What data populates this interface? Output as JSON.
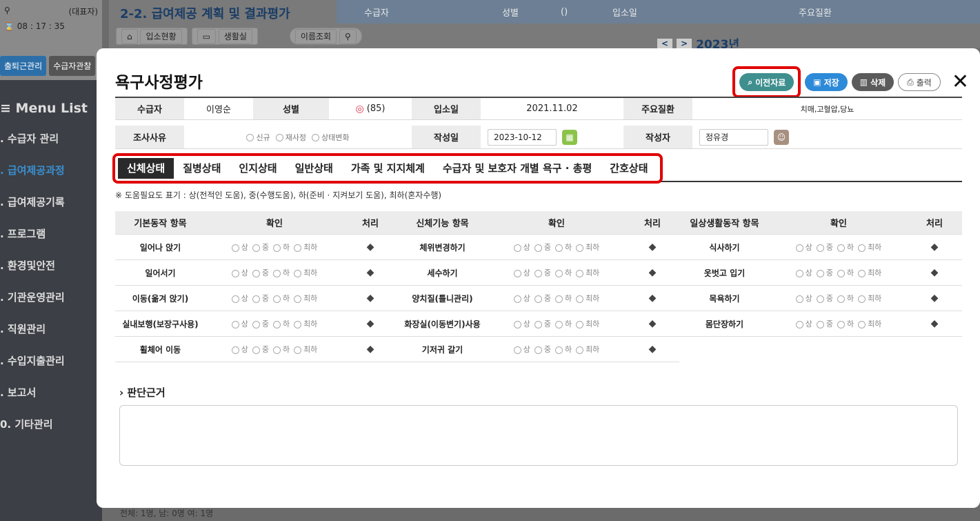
{
  "background": {
    "sidebar": {
      "search_icon": "search-icon",
      "role": "(대표자)",
      "clock": "08 : 17 : 35",
      "btn_attendance": "출퇴근관리",
      "btn_recipient": "수급자관찰",
      "menu_title": "≡ Menu List",
      "items": [
        {
          "label": ". 수급자 관리"
        },
        {
          "label": ". 급여제공과정"
        },
        {
          "label": ". 급여제공기록"
        },
        {
          "label": ". 프로그램"
        },
        {
          "label": ". 환경및안전"
        },
        {
          "label": ". 기관운영관리"
        },
        {
          "label": ". 직원관리"
        },
        {
          "label": ". 수입지출관리"
        },
        {
          "label": ". 보고서"
        },
        {
          "label": "0. 기타관리"
        }
      ],
      "active_arrow": "›"
    },
    "header": {
      "title": "2-2. 급여제공 계획 및 결과평가",
      "bar_recipient": "수급자",
      "bar_gender": "성별",
      "bar_paren": "()",
      "bar_admission": "입소일",
      "bar_disease": "주요질환",
      "tool_admission": "입소현황",
      "tool_room": "생활실",
      "tool_search": "이름조회",
      "year": "2023년",
      "prev_arrow": "<",
      "next_arrow": ">"
    },
    "bottom_text": "전체: 1명,  남: 0명  여: 1명"
  },
  "modal": {
    "title": "욕구사정평가",
    "buttons": {
      "previous": "이전자료",
      "save": "저장",
      "delete": "삭제",
      "print": "출력",
      "close": "✕"
    },
    "info": {
      "recipient_label": "수급자",
      "recipient_value": "이영순",
      "gender_label": "성별",
      "age": "(85)",
      "admission_label": "입소일",
      "admission_value": "2021.11.02",
      "disease_label": "주요질환",
      "disease_value": "치매,고혈압,당뇨",
      "reason_label": "조사사유",
      "reason_options": [
        "신규",
        "재사정",
        "상태변화"
      ],
      "written_date_label": "작성일",
      "written_date_value": "2023-10-12",
      "writer_label": "작성자",
      "writer_value": "정유경"
    },
    "tabs": [
      {
        "label": "신체상태"
      },
      {
        "label": "질병상태"
      },
      {
        "label": "인지상태"
      },
      {
        "label": "일반상태"
      },
      {
        "label": "가족 및 지지체계"
      },
      {
        "label": "수급자 및 보호자 개별 욕구 · 총평"
      },
      {
        "label": "간호상태"
      }
    ],
    "note": "※ 도움필요도 표기 : 상(전적인 도움), 중(수행도움), 하(준비 · 지켜보기 도움), 최하(혼자수행)",
    "grid": {
      "headers": {
        "basic": "기본동작 항목",
        "function": "신체기능 항목",
        "daily": "일상생활동작 항목",
        "check": "확인",
        "action": "처리"
      },
      "levels": [
        "상",
        "중",
        "하",
        "최하"
      ],
      "basic_items": [
        "일어나 앉기",
        "일어서기",
        "이동(옮겨 앉기)",
        "실내보행(보장구사용)",
        "휠체어 이동"
      ],
      "function_items": [
        "체위변경하기",
        "세수하기",
        "양치질(틀니관리)",
        "화장실(이동변기)사용",
        "기저귀 갈기"
      ],
      "daily_items": [
        "식사하기",
        "옷벗고 입기",
        "목욕하기",
        "몸단장하기"
      ]
    },
    "judge_title": "판단근거",
    "judge_arrow": "›"
  },
  "colors": {
    "previous_btn": "#3f8f8f",
    "save_btn": "#2d8ad8",
    "delete_btn": "#5b5b5b",
    "highlight": "#e10000",
    "tab_active": "#2a2a2a"
  }
}
